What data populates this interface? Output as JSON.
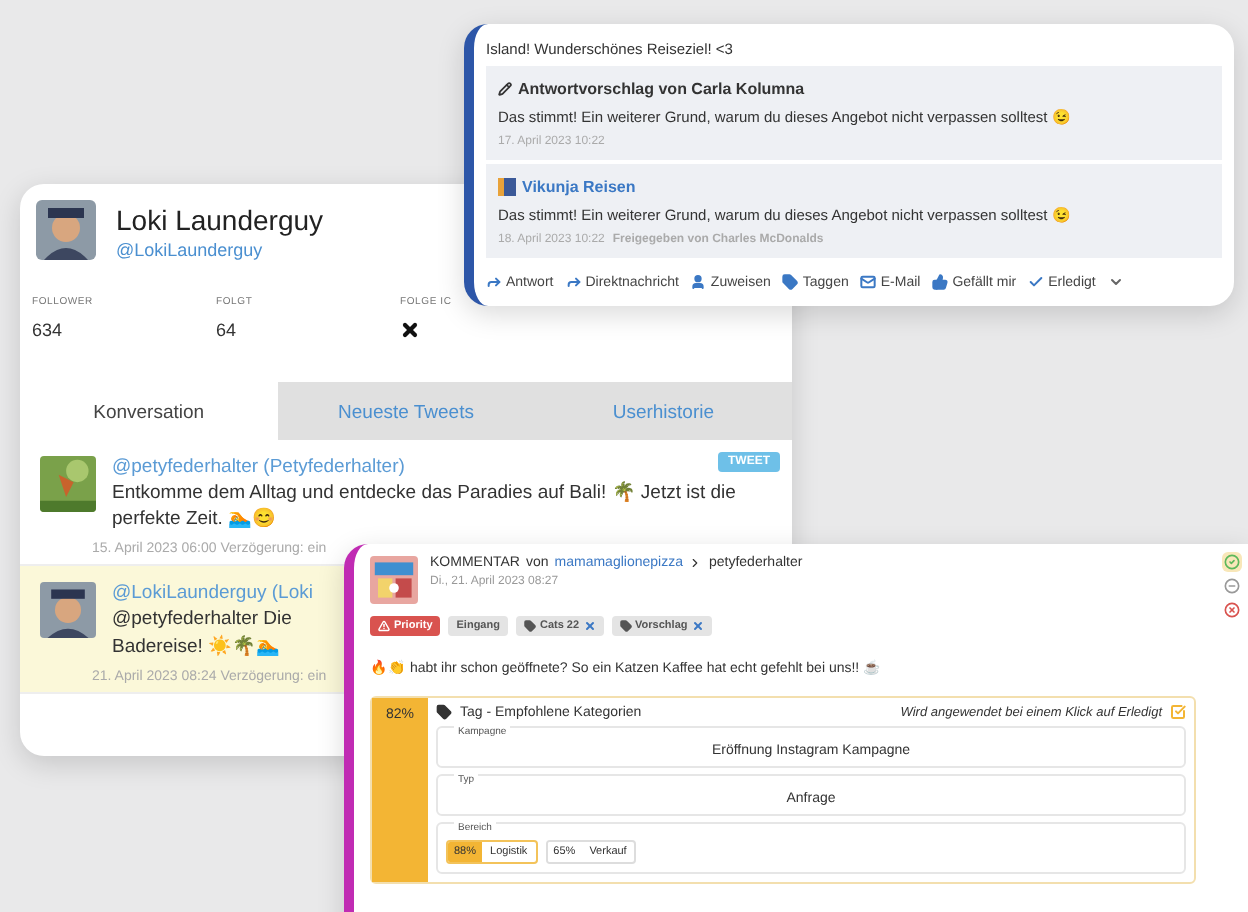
{
  "profile_card": {
    "name": "Loki Launderguy",
    "handle": "@LokiLaunderguy",
    "stats": [
      {
        "label": "FOLLOWER",
        "value": "634"
      },
      {
        "label": "FOLGT",
        "value": "64"
      },
      {
        "label": "FOLGE IC",
        "following": false
      }
    ],
    "tabs": [
      {
        "label": "Konversation",
        "selected": true
      },
      {
        "label": "Neueste Tweets",
        "selected": false
      },
      {
        "label": "Userhistorie",
        "selected": false
      }
    ],
    "tweets": [
      {
        "author": "@petyfederhalter (Petyfederhalter)",
        "badge": "TWEET",
        "text": "Entkomme dem Alltag und entdecke das Paradies auf Bali! 🌴 Jetzt ist die perfekte Zeit. 🏊😊",
        "time": "15. April 2023 06:00 Verzögerung: ein",
        "highlighted": false
      },
      {
        "author": "@LokiLaunderguy (Loki",
        "text": "@petyfederhalter Die",
        "text2": "Badereise! ☀️🌴🏊",
        "time": "21. April 2023 08:24 Verzögerung: ein",
        "highlighted": true
      }
    ]
  },
  "conversation_card": {
    "title": "Island! Wunderschönes Reiseziel! <3",
    "replies": [
      {
        "kind": "suggestion",
        "author": "Antwortvorschlag von Carla Kolumna",
        "text": "Das stimmt! Ein weiterer Grund, warum du dieses Angebot nicht verpassen solltest 😉",
        "time": "17. April 2023 10:22"
      },
      {
        "kind": "post",
        "author": "Vikunja Reisen",
        "text": "Das stimmt! Ein weiterer Grund, warum du dieses Angebot nicht verpassen solltest 😉",
        "time": "18. April 2023 10:22",
        "approval": "Freigegeben von Charles McDonalds"
      }
    ],
    "actions": [
      {
        "kind": "reply",
        "label": "Antwort"
      },
      {
        "kind": "reply",
        "label": "Direktnachricht"
      },
      {
        "kind": "user",
        "label": "Zuweisen"
      },
      {
        "kind": "tag",
        "label": "Taggen"
      },
      {
        "kind": "mail",
        "label": "E-Mail"
      },
      {
        "kind": "like",
        "label": "Gefällt mir"
      },
      {
        "kind": "check",
        "label": "Erledigt"
      }
    ]
  },
  "comment_card": {
    "type_label": "KOMMENTAR",
    "by": "von",
    "author": "mamamaglionepizza",
    "target": "petyfederhalter",
    "date": "Di., 21. April 2023 08:27",
    "tags": [
      {
        "kind": "priority",
        "label": "Priority"
      },
      {
        "kind": "plain",
        "label": "Eingang"
      },
      {
        "kind": "removable",
        "label": "Cats 22"
      },
      {
        "kind": "removable",
        "label": "Vorschlag"
      }
    ],
    "message": "🔥👏 habt ihr schon geöffnete? So ein Katzen Kaffee hat echt gefehlt bei uns!! ☕",
    "status_buttons": [
      {
        "kind": "approve",
        "selected": true
      },
      {
        "kind": "neutral",
        "selected": false
      },
      {
        "kind": "reject",
        "selected": false
      }
    ],
    "suggestion": {
      "score": "82%",
      "title": "Tag - Empfohlene Kategorien",
      "hint": "Wird angewendet bei einem Klick auf Erledigt",
      "fields": [
        {
          "kind": "value",
          "label": "Kampagne",
          "value": "Eröffnung Instagram Kampagne"
        },
        {
          "kind": "value",
          "label": "Typ",
          "value": "Anfrage"
        },
        {
          "kind": "chips",
          "label": "Bereich",
          "chips": [
            {
              "percent": "88%",
              "label": "Logistik",
              "selected": true
            },
            {
              "percent": "65%",
              "label": "Verkauf",
              "selected": false
            }
          ]
        }
      ]
    }
  }
}
